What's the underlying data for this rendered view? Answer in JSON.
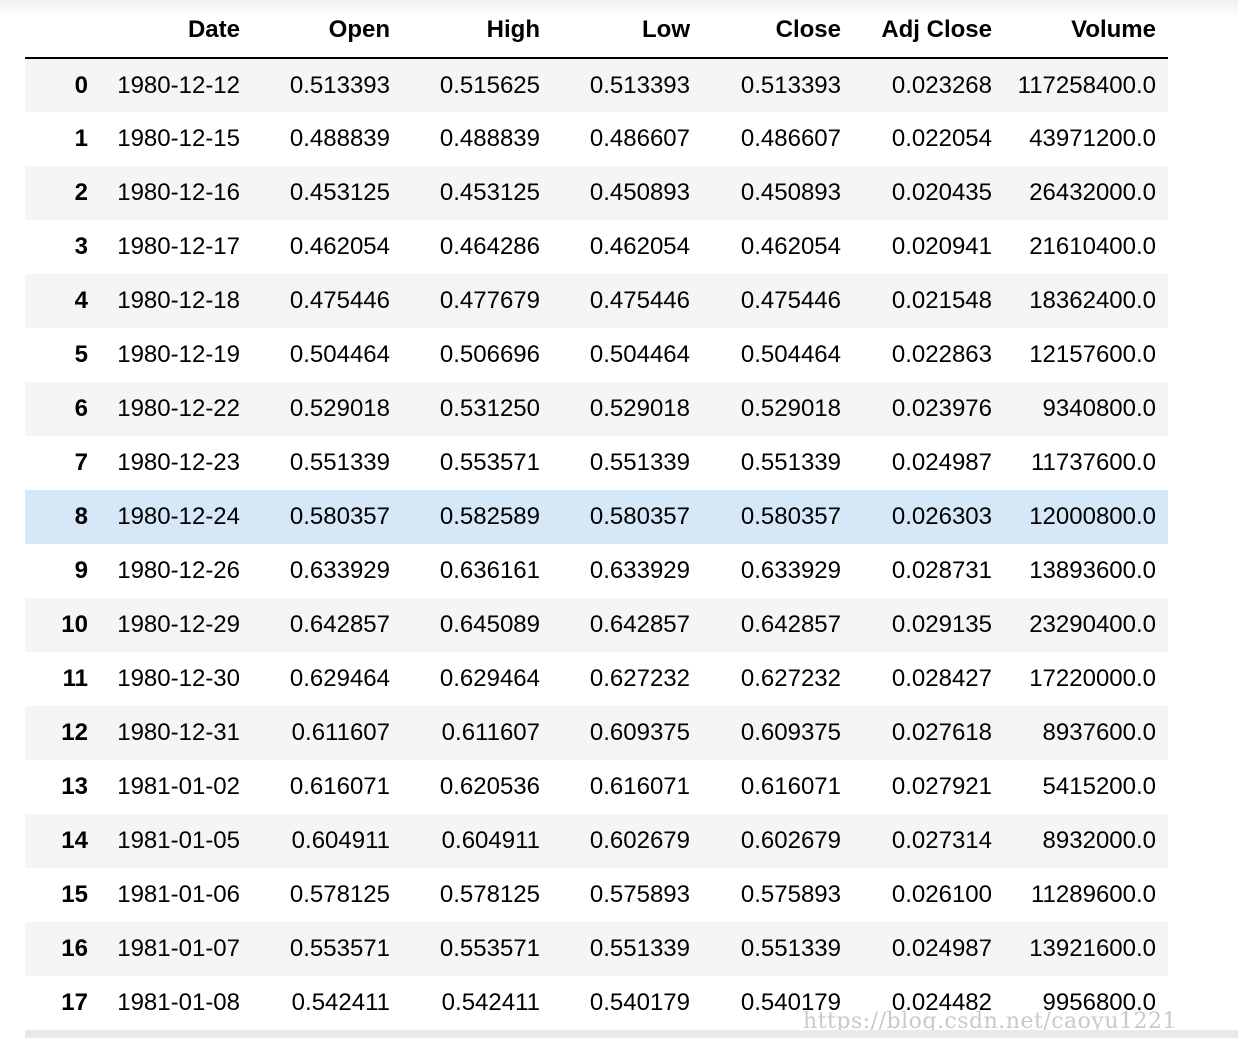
{
  "table": {
    "index_header": "",
    "columns": [
      "Date",
      "Open",
      "High",
      "Low",
      "Close",
      "Adj Close",
      "Volume"
    ],
    "rows": [
      {
        "index": "0",
        "highlighted": false,
        "cells": [
          "1980-12-12",
          "0.513393",
          "0.515625",
          "0.513393",
          "0.513393",
          "0.023268",
          "117258400.0"
        ]
      },
      {
        "index": "1",
        "highlighted": false,
        "cells": [
          "1980-12-15",
          "0.488839",
          "0.488839",
          "0.486607",
          "0.486607",
          "0.022054",
          "43971200.0"
        ]
      },
      {
        "index": "2",
        "highlighted": false,
        "cells": [
          "1980-12-16",
          "0.453125",
          "0.453125",
          "0.450893",
          "0.450893",
          "0.020435",
          "26432000.0"
        ]
      },
      {
        "index": "3",
        "highlighted": false,
        "cells": [
          "1980-12-17",
          "0.462054",
          "0.464286",
          "0.462054",
          "0.462054",
          "0.020941",
          "21610400.0"
        ]
      },
      {
        "index": "4",
        "highlighted": false,
        "cells": [
          "1980-12-18",
          "0.475446",
          "0.477679",
          "0.475446",
          "0.475446",
          "0.021548",
          "18362400.0"
        ]
      },
      {
        "index": "5",
        "highlighted": false,
        "cells": [
          "1980-12-19",
          "0.504464",
          "0.506696",
          "0.504464",
          "0.504464",
          "0.022863",
          "12157600.0"
        ]
      },
      {
        "index": "6",
        "highlighted": false,
        "cells": [
          "1980-12-22",
          "0.529018",
          "0.531250",
          "0.529018",
          "0.529018",
          "0.023976",
          "9340800.0"
        ]
      },
      {
        "index": "7",
        "highlighted": false,
        "cells": [
          "1980-12-23",
          "0.551339",
          "0.553571",
          "0.551339",
          "0.551339",
          "0.024987",
          "11737600.0"
        ]
      },
      {
        "index": "8",
        "highlighted": true,
        "cells": [
          "1980-12-24",
          "0.580357",
          "0.582589",
          "0.580357",
          "0.580357",
          "0.026303",
          "12000800.0"
        ]
      },
      {
        "index": "9",
        "highlighted": false,
        "cells": [
          "1980-12-26",
          "0.633929",
          "0.636161",
          "0.633929",
          "0.633929",
          "0.028731",
          "13893600.0"
        ]
      },
      {
        "index": "10",
        "highlighted": false,
        "cells": [
          "1980-12-29",
          "0.642857",
          "0.645089",
          "0.642857",
          "0.642857",
          "0.029135",
          "23290400.0"
        ]
      },
      {
        "index": "11",
        "highlighted": false,
        "cells": [
          "1980-12-30",
          "0.629464",
          "0.629464",
          "0.627232",
          "0.627232",
          "0.028427",
          "17220000.0"
        ]
      },
      {
        "index": "12",
        "highlighted": false,
        "cells": [
          "1980-12-31",
          "0.611607",
          "0.611607",
          "0.609375",
          "0.609375",
          "0.027618",
          "8937600.0"
        ]
      },
      {
        "index": "13",
        "highlighted": false,
        "cells": [
          "1981-01-02",
          "0.616071",
          "0.620536",
          "0.616071",
          "0.616071",
          "0.027921",
          "5415200.0"
        ]
      },
      {
        "index": "14",
        "highlighted": false,
        "cells": [
          "1981-01-05",
          "0.604911",
          "0.604911",
          "0.602679",
          "0.602679",
          "0.027314",
          "8932000.0"
        ]
      },
      {
        "index": "15",
        "highlighted": false,
        "cells": [
          "1981-01-06",
          "0.578125",
          "0.578125",
          "0.575893",
          "0.575893",
          "0.026100",
          "11289600.0"
        ]
      },
      {
        "index": "16",
        "highlighted": false,
        "cells": [
          "1981-01-07",
          "0.553571",
          "0.553571",
          "0.551339",
          "0.551339",
          "0.024987",
          "13921600.0"
        ]
      },
      {
        "index": "17",
        "highlighted": false,
        "cells": [
          "1981-01-08",
          "0.542411",
          "0.542411",
          "0.540179",
          "0.540179",
          "0.024482",
          "9956800.0"
        ]
      }
    ]
  },
  "watermark": {
    "text": "https://blog.csdn.net/caoyu1221"
  },
  "colors": {
    "row_stripe": "#f5f5f5",
    "row_highlight": "#d6e8f8",
    "header_border": "#000000",
    "scrollbar": "#e9e9e9",
    "watermark_text": "#ccc9c4"
  }
}
